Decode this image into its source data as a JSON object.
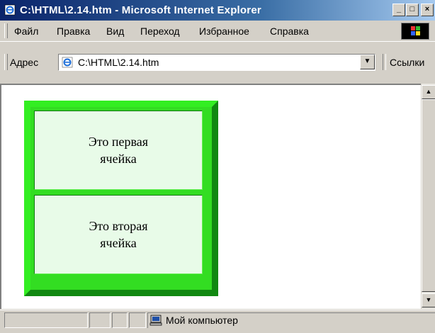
{
  "window": {
    "title": "C:\\HTML\\2.14.htm - Microsoft Internet Explorer",
    "controls": {
      "minimize": "_",
      "maximize": "□",
      "close": "×"
    }
  },
  "menu": {
    "items": [
      {
        "label": "Файл"
      },
      {
        "label": "Правка"
      },
      {
        "label": "Вид"
      },
      {
        "label": "Переход"
      },
      {
        "label": "Избранное"
      },
      {
        "label": "Справка"
      }
    ]
  },
  "address_bar": {
    "label": "Адрес",
    "value": "C:\\HTML\\2.14.htm",
    "links_label": "Ссылки"
  },
  "page": {
    "cells": [
      {
        "text": "Это первая ячейка"
      },
      {
        "text": "Это вторая ячейка"
      }
    ],
    "colors": {
      "table_border_light": "#33ee22",
      "table_border_dark": "#118811",
      "cell_background": "#e8fbe8"
    }
  },
  "status_bar": {
    "zone_label": "Мой компьютер"
  },
  "icons": {
    "app": "ie-page-icon",
    "address": "ie-page-icon",
    "status": "my-computer-icon",
    "throbber": "windows-logo-icon"
  }
}
